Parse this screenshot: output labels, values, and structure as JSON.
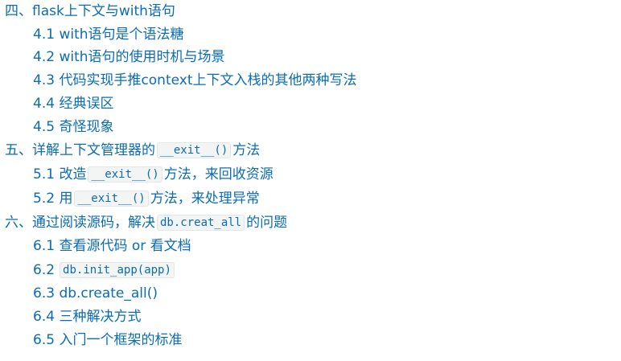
{
  "toc": {
    "s4": {
      "title": "四、flask上下文与with语句",
      "items": [
        "4.1 with语句是个语法糖",
        "4.2 with语句的使用时机与场景",
        "4.3 代码实现手推context上下文入栈的其他两种写法",
        "4.4 经典误区",
        "4.5 奇怪现象"
      ]
    },
    "s5": {
      "title_pre": "五、详解上下文管理器的",
      "title_code": "__exit__()",
      "title_post": "方法",
      "item1_pre": "5.1 改造",
      "item1_code": "__exit__()",
      "item1_post": "方法，来回收资源",
      "item2_pre": "5.2 用",
      "item2_code": "__exit__()",
      "item2_post": "方法，来处理异常"
    },
    "s6": {
      "title_pre": "六、通过阅读源码，解决",
      "title_code": "db.creat_all",
      "title_post": "的问题",
      "item1": "6.1 查看源代码 or 看文档",
      "item2_pre": "6.2",
      "item2_code": "db.init_app(app)",
      "item3": "6.3 db.create_all()",
      "item4": "6.4 三种解决方式",
      "item5": "6.5 入门一个框架的标准"
    }
  }
}
